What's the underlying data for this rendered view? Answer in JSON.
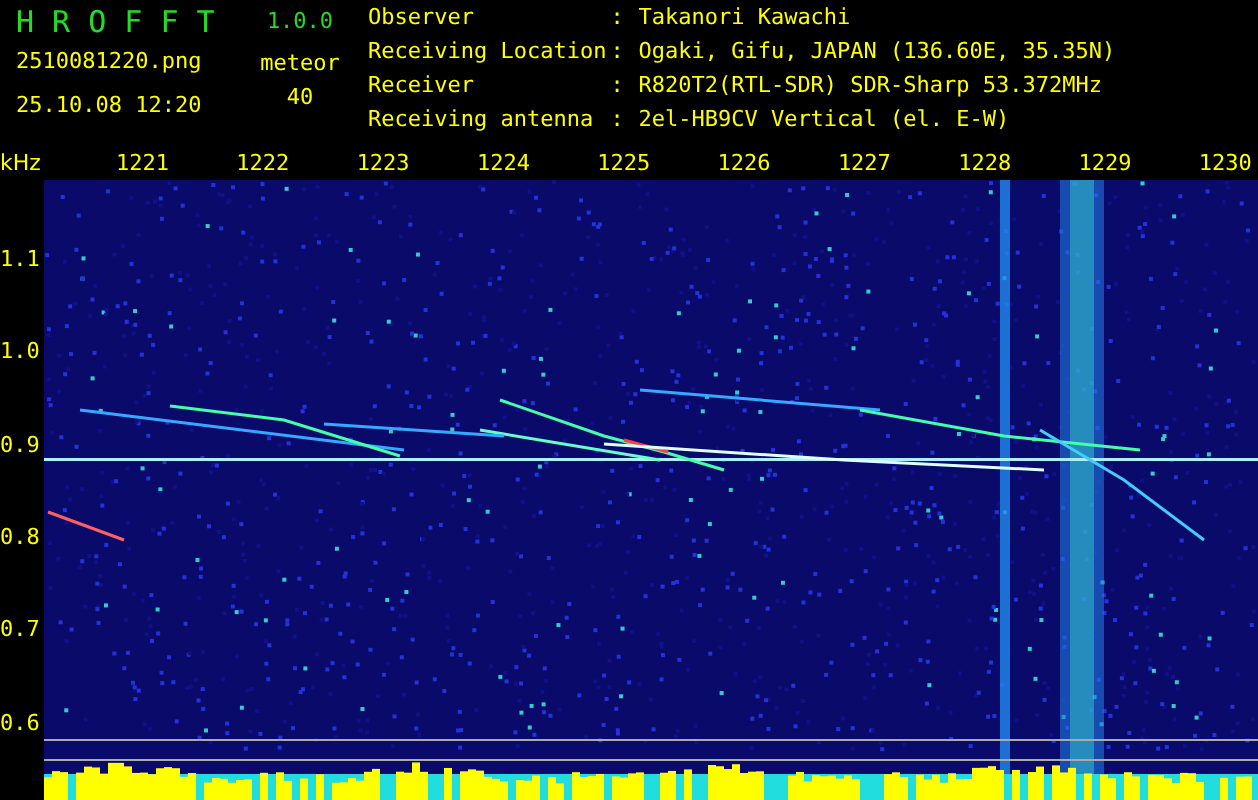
{
  "app": {
    "name": "H R O F F T",
    "version": "1.0.0"
  },
  "capture": {
    "file": "2510081220.png",
    "datetime": "25.10.08 12:20",
    "count_label": "meteor",
    "count": "40"
  },
  "station": [
    {
      "label": "Observer",
      "colon": ":",
      "value": "Takanori Kawachi"
    },
    {
      "label": "Receiving Location",
      "colon": ":",
      "value": "Ogaki, Gifu, JAPAN (136.60E, 35.35N)"
    },
    {
      "label": "Receiver",
      "colon": ":",
      "value": "R820T2(RTL-SDR) SDR-Sharp 53.372MHz"
    },
    {
      "label": "Receiving antenna",
      "colon": ":",
      "value": "2el-HB9CV Vertical (el. E-W)"
    }
  ],
  "x_axis": {
    "unit": "kHz",
    "labels": [
      "1221",
      "1222",
      "1223",
      "1224",
      "1225",
      "1226",
      "1227",
      "1228",
      "1229",
      "1230"
    ]
  },
  "y_axis": {
    "labels": [
      "1.1",
      "1.0",
      "0.9",
      "0.8",
      "0.7",
      "0.6"
    ]
  }
}
